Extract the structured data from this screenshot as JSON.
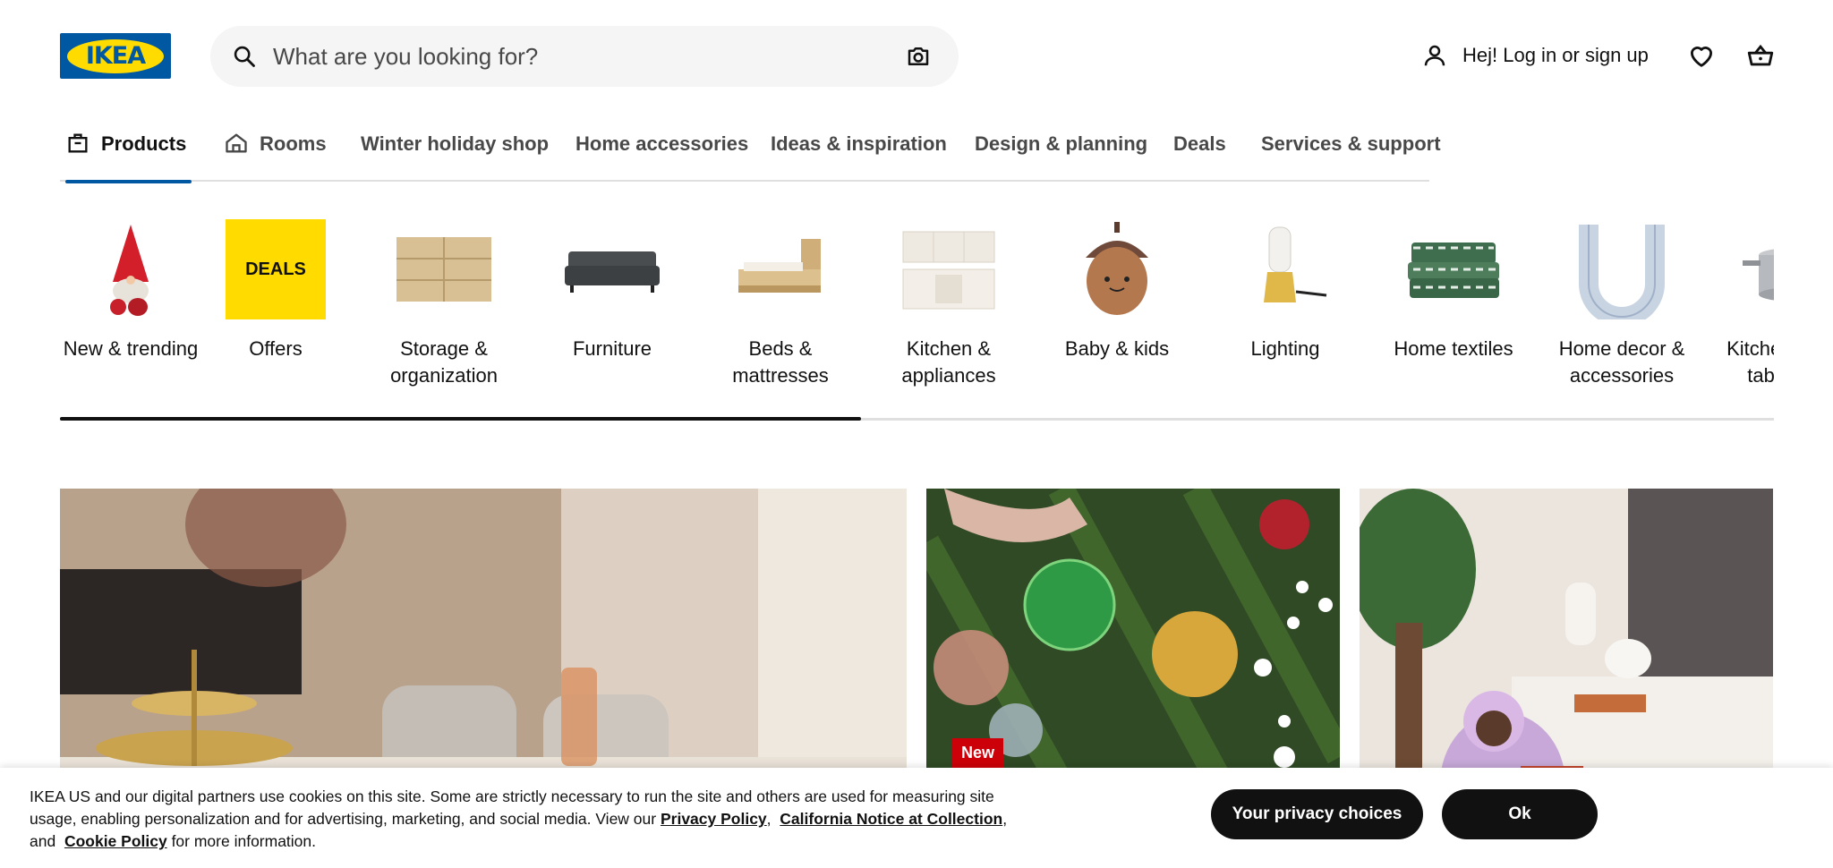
{
  "brand": {
    "logo_text": "IKEA",
    "blue": "#0058a3",
    "yellow": "#ffdb00"
  },
  "search": {
    "placeholder": "What are you looking for?"
  },
  "account": {
    "login_label": "Hej! Log in or sign up"
  },
  "nav": {
    "tabs": [
      {
        "label": "Products",
        "active": true
      },
      {
        "label": "Rooms"
      },
      {
        "label": "Winter holiday shop"
      },
      {
        "label": "Home accessories"
      },
      {
        "label": "Ideas & inspiration"
      },
      {
        "label": "Design & planning"
      },
      {
        "label": "Deals"
      },
      {
        "label": "Services & support"
      }
    ]
  },
  "categories": [
    {
      "label": "New & trending",
      "icon": "gnome-icon"
    },
    {
      "label": "Offers",
      "icon": "deals-tile",
      "tile_text": "DEALS"
    },
    {
      "label": "Storage & organization",
      "icon": "dresser-icon"
    },
    {
      "label": "Furniture",
      "icon": "sofa-icon"
    },
    {
      "label": "Beds & mattresses",
      "icon": "bed-icon"
    },
    {
      "label": "Kitchen & appliances",
      "icon": "kitchen-icon"
    },
    {
      "label": "Baby & kids",
      "icon": "acorn-plush-icon"
    },
    {
      "label": "Lighting",
      "icon": "lantern-icon"
    },
    {
      "label": "Home textiles",
      "icon": "textiles-icon"
    },
    {
      "label": "Home decor & accessories",
      "icon": "vase-icon"
    },
    {
      "label": "Kitchenware & tableware",
      "icon": "pot-icon"
    }
  ],
  "hero": {
    "badge_new": "New"
  },
  "cookie": {
    "text": "IKEA US and our digital partners use cookies on this site. Some are strictly necessary to run the site and others are used for measuring site usage, enabling personalization and for advertising, marketing, and social media. View our ",
    "privacy_link": "Privacy Policy",
    "sep1": ",",
    "california_link": "California Notice at Collection",
    "sep2": ", and ",
    "cookie_link": "Cookie Policy",
    "tail": " for more information.",
    "privacy_choices_button": "Your privacy choices",
    "ok_button": "Ok"
  }
}
